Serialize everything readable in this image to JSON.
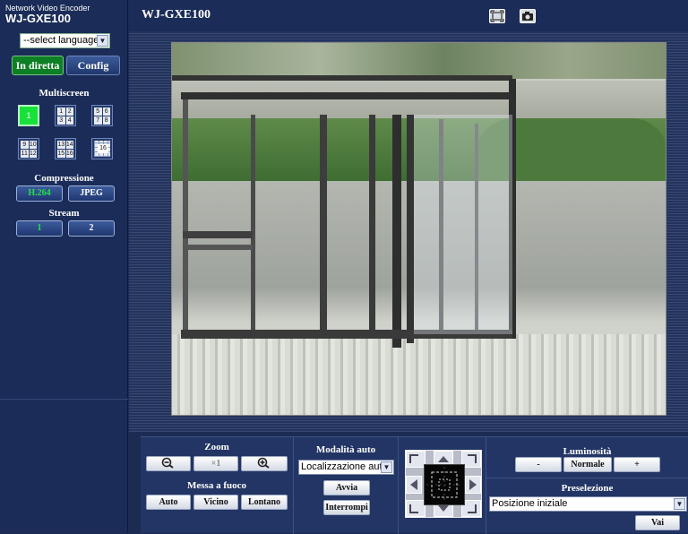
{
  "brand": {
    "subtitle": "Network Video Encoder",
    "model": "WJ-GXE100"
  },
  "language_select": {
    "value": "--select language--"
  },
  "mode_buttons": {
    "live": "In diretta",
    "config": "Config"
  },
  "multiscreen": {
    "label": "Multiscreen",
    "layouts": [
      {
        "cells": [
          "1"
        ]
      },
      {
        "cells": [
          "1",
          "2",
          "3",
          "4"
        ]
      },
      {
        "cells": [
          "5",
          "6",
          "7",
          "8"
        ]
      },
      {
        "cells": [
          "9",
          "10",
          "11",
          "12"
        ]
      },
      {
        "cells": [
          "13",
          "14",
          "15",
          "16"
        ]
      },
      {
        "cells": [
          "16"
        ]
      }
    ]
  },
  "compression": {
    "label": "Compressione",
    "options": [
      "H.264",
      "JPEG"
    ],
    "selected": "H.264"
  },
  "stream": {
    "label": "Stream",
    "options": [
      "1",
      "2"
    ],
    "selected": "1"
  },
  "header": {
    "title": "WJ-GXE100",
    "icons": [
      "fullscreen-icon",
      "snapshot-camera-icon"
    ]
  },
  "zoom": {
    "label": "Zoom",
    "buttons": [
      "zoom-out-icon",
      "×1",
      "zoom-in-icon"
    ]
  },
  "focus": {
    "label": "Messa a fuoco",
    "buttons": [
      "Auto",
      "Vicino",
      "Lontano"
    ]
  },
  "auto_mode": {
    "label": "Modalità auto",
    "select_value": "Localizzazione auto",
    "start": "Avvia",
    "stop": "Interrompi"
  },
  "brightness": {
    "label": "Luminosità",
    "buttons": [
      "-",
      "Normale",
      "+"
    ]
  },
  "preset": {
    "label": "Preselezione",
    "select_value": "Posizione iniziale",
    "go": "Vai"
  },
  "colors": {
    "accent_green": "#18e23a",
    "live_button": "#0d7f24",
    "background": "#1b2b52"
  }
}
